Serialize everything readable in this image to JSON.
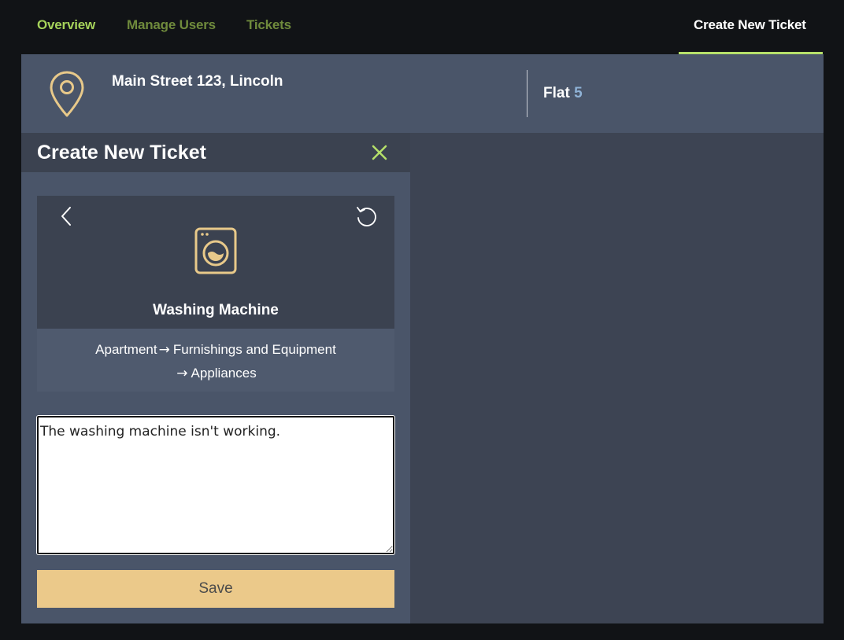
{
  "nav": {
    "items": [
      {
        "label": "Overview"
      },
      {
        "label": "Manage Users"
      },
      {
        "label": "Tickets"
      }
    ],
    "active_label": "Create New Ticket"
  },
  "location": {
    "address": "Main Street 123, Lincoln",
    "flat_label": "Flat",
    "flat_number": "5"
  },
  "panel": {
    "title": "Create New Ticket",
    "item_title": "Washing Machine",
    "breadcrumb": {
      "line1_a": "Apartment",
      "line1_b": "Furnishings and Equipment",
      "line2": "Appliances"
    },
    "description_value": "The washing machine isn't working.",
    "save_label": "Save"
  },
  "colors": {
    "accent": "#b6e06a",
    "save_button": "#ebc98a",
    "icon": "#e8c98a"
  },
  "icons": [
    "map-pin-icon",
    "close-icon",
    "chevron-left-icon",
    "reset-icon",
    "washing-machine-icon",
    "arrow-right-icon"
  ]
}
